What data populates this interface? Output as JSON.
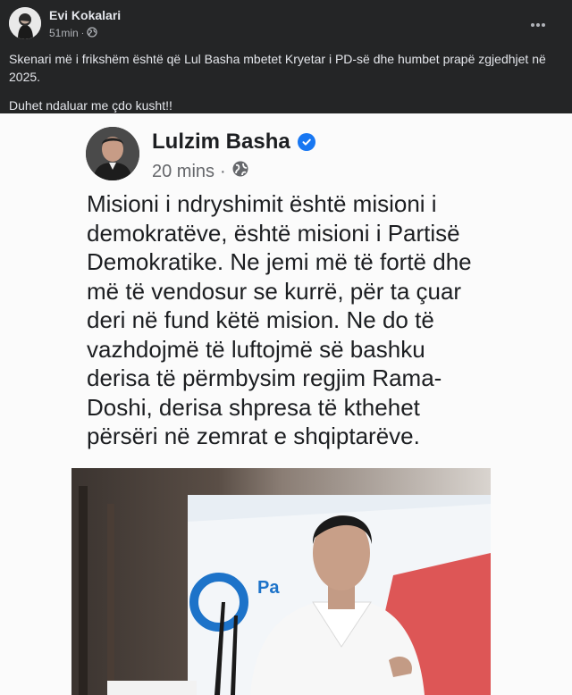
{
  "post": {
    "author": "Evi Kokalari",
    "time": "51min",
    "separator": "·",
    "audience_icon": "globe-icon",
    "text_lines": [
      "Skenari më i frikshëm është që Lul Basha mbetet Kryetar i PD-së dhe humbet prapë zgjedhjet në 2025.",
      "Duhet ndaluar me çdo kusht!!"
    ]
  },
  "screenshot": {
    "author": "Lulzim Basha",
    "time": "20 mins",
    "separator": "·",
    "body": "Misioni i ndryshimit është misioni i\ndemokratëve, është misioni i Partisë\nDemokratike. Ne jemi më të fortë dhe\nmë të vendosur se kurrë, për ta çuar\nderi në fund këtë mision. Ne do të\nvazhdojmë të luftojmë së bashku\nderisa të përmbysim regjim Rama-\nDoshi, derisa shpresa të kthehet\npërsëri në zemrat e shqiptarëve.",
    "photo_caption_fragment": "Pa"
  },
  "colors": {
    "post_bg": "#242526",
    "text_primary": "#e4e6eb",
    "text_secondary": "#b0b3b8",
    "verified": "#1877f2"
  }
}
